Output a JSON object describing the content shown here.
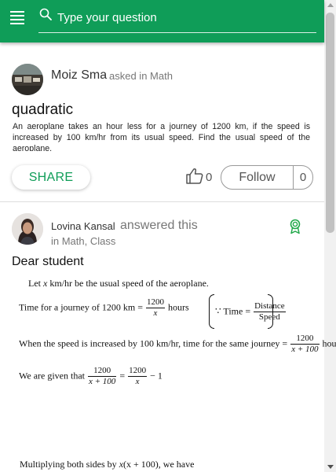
{
  "search": {
    "placeholder": "Type your question"
  },
  "question": {
    "asker_name": "Moiz Sma",
    "asker_meta": "asked in Math",
    "title": "quadratic",
    "body": "An aeroplane takes an hour less for a journey of 1200 km, if the speed is increased by 100 km/hr from its usual speed. Find the usual speed of the aeroplane.",
    "share_label": "SHARE",
    "like_count": "0",
    "follow_label": "Follow",
    "follow_count": "0"
  },
  "answer": {
    "answerer_name": "Lovina Kansal",
    "action": "answered this",
    "meta": "in Math, Class",
    "greeting": "Dear student",
    "lines": {
      "l1_a": "Let ",
      "l1_var": "x",
      "l1_b": " km/hr be the usual speed of the aeroplane.",
      "l2_a": "Time for a journey of 1200 km = ",
      "l2_num": "1200",
      "l2_den": "x",
      "l2_b": " hours",
      "l2_note_a": "∵ Time = ",
      "l2_note_num": "Distance",
      "l2_note_den": "Speed",
      "l3_a": "When the speed is increased by 100 km/hr, time for the same journey = ",
      "l3_num": "1200",
      "l3_den": "x + 100",
      "l3_b": " hours.",
      "l4_a": "We are given that ",
      "l4_num1": "1200",
      "l4_den1": "x + 100",
      "l4_eq": " = ",
      "l4_num2": "1200",
      "l4_den2": "x",
      "l4_b": " − 1",
      "l5_a": "Multiplying both sides by ",
      "l5_var": "x",
      "l5_b": "(x + 100), we have"
    }
  },
  "colors": {
    "brand": "#0f9d58",
    "badge": "#22a84a"
  },
  "icons": [
    "menu-icon",
    "search-icon",
    "thumbs-up-icon",
    "award-ribbon-icon"
  ]
}
